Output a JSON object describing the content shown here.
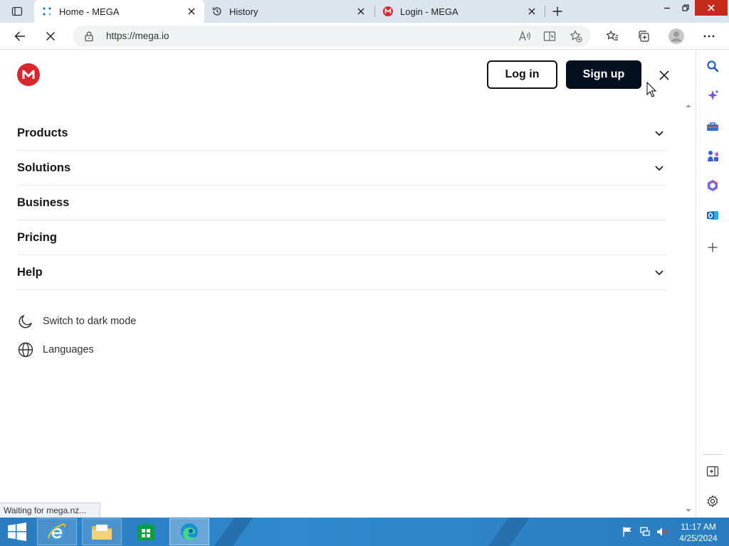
{
  "browser": {
    "tabs": [
      {
        "title": "Home - MEGA",
        "active": true
      },
      {
        "title": "History",
        "active": false
      },
      {
        "title": "Login - MEGA",
        "active": false
      }
    ],
    "address_url": "https://mega.io",
    "status_text": "Waiting for mega.nz..."
  },
  "header": {
    "logo_letter": "M",
    "login_label": "Log in",
    "signup_label": "Sign up"
  },
  "menu": {
    "items": [
      {
        "label": "Products",
        "expandable": true
      },
      {
        "label": "Solutions",
        "expandable": true
      },
      {
        "label": "Business",
        "expandable": false
      },
      {
        "label": "Pricing",
        "expandable": false
      },
      {
        "label": "Help",
        "expandable": true
      }
    ],
    "dark_mode_label": "Switch to dark mode",
    "languages_label": "Languages"
  },
  "taskbar": {
    "time": "11:17 AM",
    "date": "4/25/2024"
  },
  "colors": {
    "mega_red": "#d9272e",
    "signup_bg": "#04101e",
    "taskbar": "#2a7cbf",
    "titlebar": "#dce4ee"
  },
  "icons": {
    "sidebar": [
      "search-icon",
      "copilot-icon",
      "tools-icon",
      "games-icon",
      "office-icon",
      "outlook-icon",
      "add-icon",
      "split-screen-icon",
      "settings-icon"
    ],
    "tray": [
      "flag-icon",
      "network-icon",
      "volume-muted-icon"
    ]
  }
}
